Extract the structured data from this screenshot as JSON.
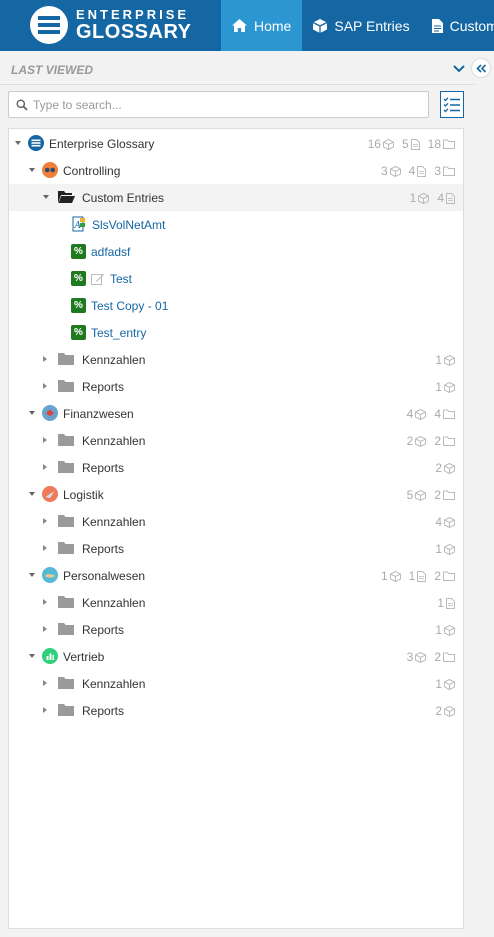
{
  "app": {
    "logo_line1": "ENTERPRISE",
    "logo_line2": "GLOSSARY"
  },
  "nav": {
    "tabs": [
      "Home",
      "SAP Entries",
      "Custom Entries"
    ],
    "active": "Home"
  },
  "colors": {
    "brand": "#1467a3",
    "active_tab": "#2c96d3",
    "link": "#1467a3",
    "tag_green": "#1f7a1f"
  },
  "sidebar": {
    "last_viewed_label": "LAST VIEWED"
  },
  "search": {
    "placeholder": "Type to search..."
  },
  "tree": {
    "rows": [
      {
        "label": "Enterprise Glossary",
        "level": 0,
        "state": "open",
        "icon": "enterprise-glossary-icon",
        "counts": [
          {
            "n": "16",
            "type": "sap"
          },
          {
            "n": "5",
            "type": "custom"
          },
          {
            "n": "18",
            "type": "folder"
          }
        ]
      },
      {
        "label": "Controlling",
        "level": 1,
        "state": "open",
        "icon": "controlling-area-icon",
        "counts": [
          {
            "n": "3",
            "type": "sap"
          },
          {
            "n": "4",
            "type": "custom"
          },
          {
            "n": "3",
            "type": "folder"
          }
        ]
      },
      {
        "label": "Custom Entries",
        "level": 2,
        "state": "open",
        "icon": "folder-open-icon",
        "selected": true,
        "counts": [
          {
            "n": "1",
            "type": "sap"
          },
          {
            "n": "4",
            "type": "custom"
          }
        ]
      },
      {
        "label": "SlsVolNetAmt",
        "level": 3,
        "state": "leaf",
        "icon": "sap-measure-icon",
        "link": true
      },
      {
        "label": "adfadsf",
        "level": 3,
        "state": "leaf",
        "icon": "percent-tag-icon",
        "link": true
      },
      {
        "label": "Test",
        "level": 3,
        "state": "leaf",
        "icon": "percent-tag-icon",
        "edit": true,
        "link": true
      },
      {
        "label": "Test Copy - 01",
        "level": 3,
        "state": "leaf",
        "icon": "percent-tag-icon",
        "link": true
      },
      {
        "label": "Test_entry",
        "level": 3,
        "state": "leaf",
        "icon": "percent-tag-icon",
        "link": true
      },
      {
        "label": "Kennzahlen",
        "level": 2,
        "state": "closed",
        "icon": "folder-icon",
        "counts": [
          {
            "n": "1",
            "type": "sap"
          }
        ]
      },
      {
        "label": "Reports",
        "level": 2,
        "state": "closed",
        "icon": "folder-icon",
        "counts": [
          {
            "n": "1",
            "type": "sap"
          }
        ]
      },
      {
        "label": "Finanzwesen",
        "level": 1,
        "state": "open",
        "icon": "finance-area-icon",
        "counts": [
          {
            "n": "4",
            "type": "sap"
          },
          {
            "n": "4",
            "type": "folder"
          }
        ]
      },
      {
        "label": "Kennzahlen",
        "level": 2,
        "state": "closed",
        "icon": "folder-icon",
        "counts": [
          {
            "n": "2",
            "type": "sap"
          },
          {
            "n": "2",
            "type": "folder"
          }
        ]
      },
      {
        "label": "Reports",
        "level": 2,
        "state": "closed",
        "icon": "folder-icon",
        "counts": [
          {
            "n": "2",
            "type": "sap"
          }
        ]
      },
      {
        "label": "Logistik",
        "level": 1,
        "state": "open",
        "icon": "logistics-area-icon",
        "counts": [
          {
            "n": "5",
            "type": "sap"
          },
          {
            "n": "2",
            "type": "folder"
          }
        ]
      },
      {
        "label": "Kennzahlen",
        "level": 2,
        "state": "closed",
        "icon": "folder-icon",
        "counts": [
          {
            "n": "4",
            "type": "sap"
          }
        ]
      },
      {
        "label": "Reports",
        "level": 2,
        "state": "closed",
        "icon": "folder-icon",
        "counts": [
          {
            "n": "1",
            "type": "sap"
          }
        ]
      },
      {
        "label": "Personalwesen",
        "level": 1,
        "state": "open",
        "icon": "personnel-area-icon",
        "counts": [
          {
            "n": "1",
            "type": "sap"
          },
          {
            "n": "1",
            "type": "custom"
          },
          {
            "n": "2",
            "type": "folder"
          }
        ]
      },
      {
        "label": "Kennzahlen",
        "level": 2,
        "state": "closed",
        "icon": "folder-icon",
        "counts": [
          {
            "n": "1",
            "type": "custom"
          }
        ]
      },
      {
        "label": "Reports",
        "level": 2,
        "state": "closed",
        "icon": "folder-icon",
        "counts": [
          {
            "n": "1",
            "type": "sap"
          }
        ]
      },
      {
        "label": "Vertrieb",
        "level": 1,
        "state": "open",
        "icon": "sales-area-icon",
        "counts": [
          {
            "n": "3",
            "type": "sap"
          },
          {
            "n": "2",
            "type": "folder"
          }
        ]
      },
      {
        "label": "Kennzahlen",
        "level": 2,
        "state": "closed",
        "icon": "folder-icon",
        "counts": [
          {
            "n": "1",
            "type": "sap"
          }
        ]
      },
      {
        "label": "Reports",
        "level": 2,
        "state": "closed",
        "icon": "folder-icon",
        "counts": [
          {
            "n": "2",
            "type": "sap"
          }
        ]
      }
    ]
  }
}
